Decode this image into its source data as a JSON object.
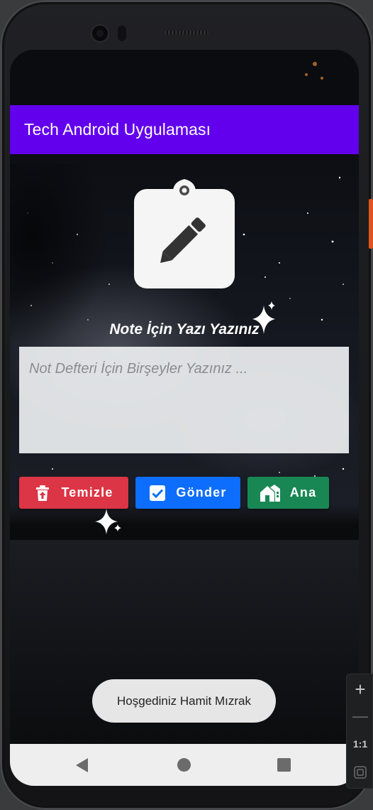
{
  "app": {
    "title": "Tech Android Uygulaması",
    "accent_color": "#6200ee"
  },
  "illustration": {
    "icon": "clipboard-pencil-icon"
  },
  "note": {
    "label": "Note İçin Yazı Yazınız",
    "placeholder": "Not Defteri İçin Birşeyler Yazınız ...",
    "value": ""
  },
  "buttons": {
    "clear": {
      "label": "Temizle",
      "icon": "trash-icon",
      "color": "#dc3545"
    },
    "send": {
      "label": "Gönder",
      "icon": "check-square-icon",
      "color": "#0d6efd"
    },
    "home": {
      "label": "Ana",
      "icon": "home-icon",
      "color": "#198754"
    }
  },
  "toast": {
    "message": "Hoşgediniz Hamit Mızrak"
  },
  "navbar": {
    "back": "back-triangle-icon",
    "home": "home-circle-icon",
    "recents": "recents-square-icon"
  },
  "emulator_toolbar": {
    "zoom_in": "+",
    "zoom_out": "—",
    "ratio": "1:1",
    "fit": "fit-screen-icon"
  }
}
